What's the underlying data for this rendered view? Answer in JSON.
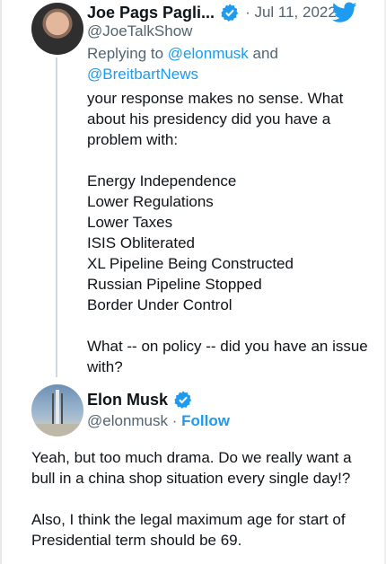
{
  "first_tweet": {
    "name": "Joe Pags Pagli...",
    "date": "Jul 11, 2022",
    "handle": "@JoeTalkShow",
    "replying_prefix": "Replying to",
    "replying_user_1": "@elonmusk",
    "replying_and": "and",
    "replying_user_2": "@BreitbartNews",
    "line1": "your response makes no sense. What about his presidency did you have a problem with:",
    "items": [
      "Energy Independence",
      "Lower Regulations",
      "Lower Taxes",
      "ISIS Obliterated",
      "XL Pipeline Being Constructed",
      "Russian Pipeline Stopped",
      "Border Under Control"
    ],
    "closing": "What -- on policy -- did you have an issue with?"
  },
  "second_tweet": {
    "name": "Elon Musk",
    "handle": "@elonmusk",
    "follow_label": "Follow",
    "paragraph_1": "Yeah, but too much drama. Do we really want a bull in a china shop situation every single day!?",
    "paragraph_2": "Also, I think the legal maximum age for start of Presidential term should be 69."
  },
  "icons": {
    "verified": "verified-badge-icon",
    "brand": "twitter-bird-icon"
  },
  "colors": {
    "accent": "#1d9bf0",
    "secondary_text": "#536471",
    "thread_line": "#cfd9de"
  }
}
